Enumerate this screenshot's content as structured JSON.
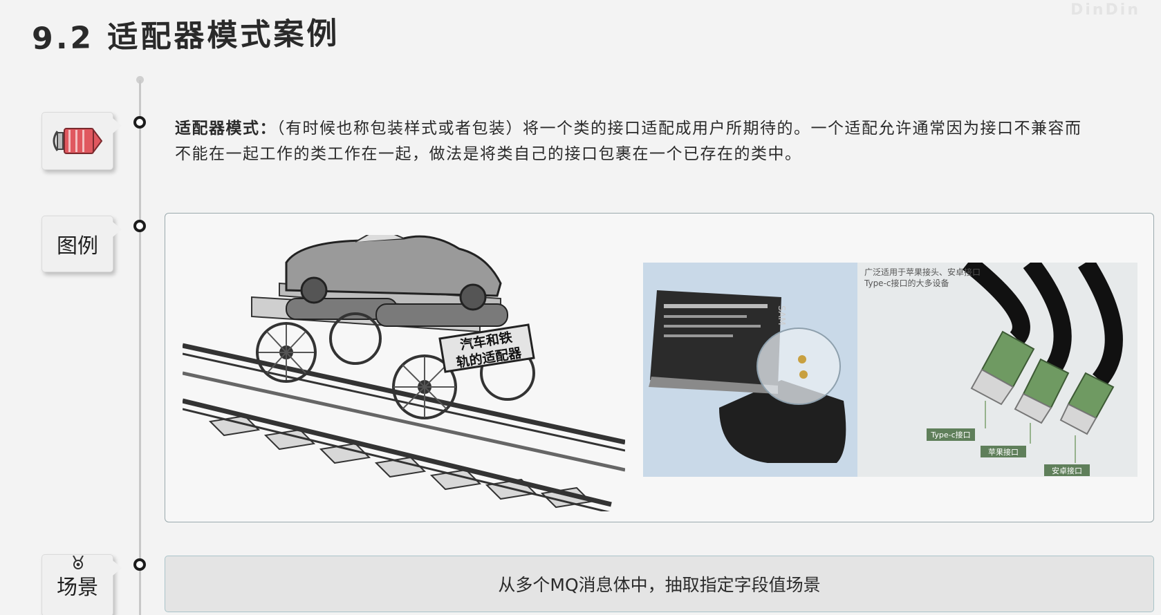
{
  "slide": {
    "title": "9.2 适配器模式案例",
    "definition": {
      "label": "适配器模式：",
      "text": "（有时候也称包装样式或者包装）将一个类的接口适配成用户所期待的。一个适配允许通常因为接口不兼容而不能在一起工作的类工作在一起，做法是将类自己的接口包裹在一个已存在的类中。"
    },
    "tags": {
      "example": "图例",
      "scene": "场景"
    },
    "example": {
      "rail_label_line1": "汽车和铁",
      "rail_label_line2": "轨的适配器",
      "cable_caption_line1": "广泛适用于苹果接头、安卓接口",
      "cable_caption_line2": "Type-c接口的大多设备",
      "cable_label_typec": "Type-c接口",
      "cable_label_apple": "苹果接口",
      "cable_label_android": "安卓接口",
      "battery_brand": "SAM"
    },
    "scene_text": "从多个MQ消息体中，抽取指定字段值场景"
  },
  "colors": {
    "background": "#f3f3f3",
    "timeline": "#c8c8c8",
    "icon_red": "#e0585f",
    "cable_green": "#6f9a62",
    "example_border": "#9aa9ad",
    "scene_background": "#e4e4e4"
  },
  "icons": {
    "section_icon": "adapter-plug-icon",
    "medal": "medal-icon"
  }
}
